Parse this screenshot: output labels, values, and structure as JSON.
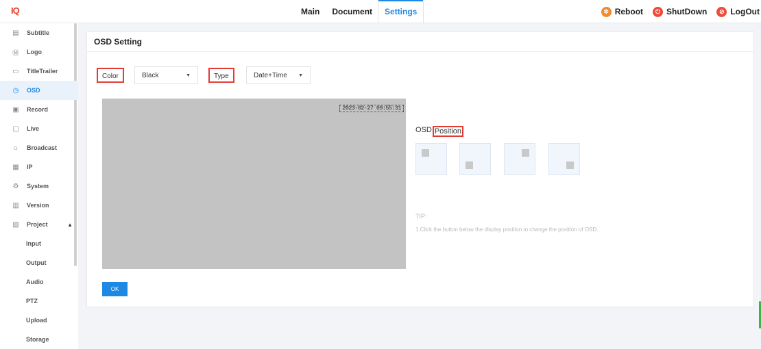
{
  "header": {
    "logo": {
      "part1": "I",
      "part2": "Q"
    },
    "nav": [
      {
        "label": "Main",
        "active": false
      },
      {
        "label": "Document",
        "active": false
      },
      {
        "label": "Settings",
        "active": true
      }
    ],
    "actions": [
      {
        "label": "Reboot",
        "icon": "gear-icon",
        "color": "#f08a2a"
      },
      {
        "label": "ShutDown",
        "icon": "power-icon",
        "color": "#ee4b3a"
      },
      {
        "label": "LogOut",
        "icon": "no-entry-icon",
        "color": "#ee4b3a"
      }
    ]
  },
  "sidebar": {
    "items": [
      {
        "label": "Subtitle",
        "icon": "subtitle-icon"
      },
      {
        "label": "Logo",
        "icon": "logo-circle-icon"
      },
      {
        "label": "TitleTrailer",
        "icon": "title-trailer-icon"
      },
      {
        "label": "OSD",
        "icon": "clock-icon",
        "active": true
      },
      {
        "label": "Record",
        "icon": "record-icon"
      },
      {
        "label": "Live",
        "icon": "live-icon"
      },
      {
        "label": "Broadcast",
        "icon": "broadcast-icon"
      },
      {
        "label": "IP",
        "icon": "monitor-icon"
      },
      {
        "label": "System",
        "icon": "system-icon"
      },
      {
        "label": "Version",
        "icon": "version-icon"
      },
      {
        "label": "Project",
        "icon": "project-icon",
        "expanded": true
      }
    ],
    "sub_items": [
      "Input",
      "Output",
      "Audio",
      "PTZ",
      "Upload",
      "Storage"
    ]
  },
  "panel": {
    "title": "OSD Setting",
    "color_label": "Color",
    "color_value": "Black",
    "type_label": "Type",
    "type_value": "Date+Time",
    "osd_timestamp": "2023-02-27 09:55:31",
    "position_prefix": "OSD",
    "position_label": "Position",
    "tip_title": "TIP:",
    "tip_text": "1.Click the button below the display position to change the position of OSD.",
    "ok_label": "OK",
    "accent_color": "#1e88e5",
    "highlight_color": "#e33a32"
  }
}
